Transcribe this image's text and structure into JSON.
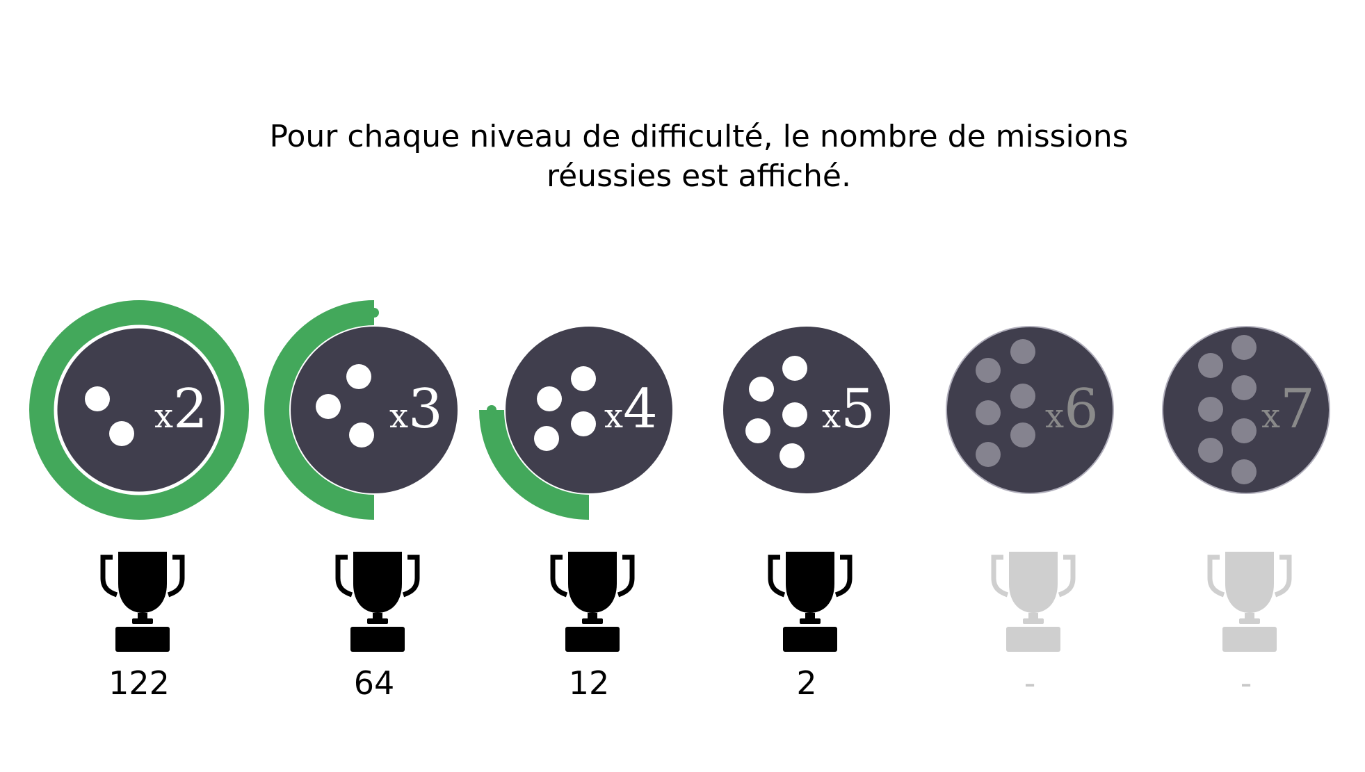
{
  "caption": {
    "line1": "Pour chaque niveau de difficulté, le nombre de missions",
    "line2": "réussies est affiché."
  },
  "colors": {
    "progress": "#43a85b",
    "disc": "#403e4d",
    "pip": "#ffffff",
    "pip_locked": "#85838f",
    "text_locked": "#8a8a8a",
    "trophy": "#000000",
    "trophy_locked": "#cfcfcf"
  },
  "levels": [
    {
      "multiplier": "x2",
      "dice": 2,
      "count": "122",
      "progress": 1.0,
      "locked": false,
      "icon": "trophy-icon"
    },
    {
      "multiplier": "x3",
      "dice": 3,
      "count": "64",
      "progress": 0.5,
      "locked": false,
      "icon": "trophy-icon"
    },
    {
      "multiplier": "x4",
      "dice": 4,
      "count": "12",
      "progress": 0.25,
      "locked": false,
      "icon": "trophy-icon"
    },
    {
      "multiplier": "x5",
      "dice": 5,
      "count": "2",
      "progress": 0.0,
      "locked": false,
      "icon": "trophy-icon"
    },
    {
      "multiplier": "x6",
      "dice": 6,
      "count": "-",
      "progress": 0.0,
      "locked": true,
      "icon": "trophy-icon"
    },
    {
      "multiplier": "x7",
      "dice": 7,
      "count": "-",
      "progress": 0.0,
      "locked": true,
      "icon": "trophy-icon"
    }
  ]
}
